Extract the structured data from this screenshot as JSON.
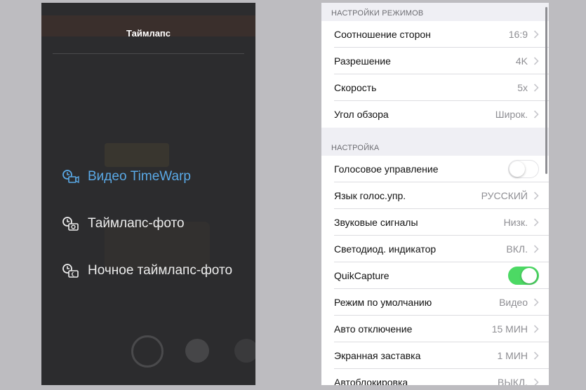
{
  "left": {
    "title": "Таймлапс",
    "modes": [
      {
        "label": "Видео TimeWarp",
        "icon": "timewarp-video-icon",
        "active": true
      },
      {
        "label": "Таймлапс-фото",
        "icon": "timelapse-photo-icon",
        "active": false
      },
      {
        "label": "Ночное таймлапс-фото",
        "icon": "night-timelapse-photo-icon",
        "active": false
      }
    ],
    "active_color": "#5aa9e6"
  },
  "right": {
    "sections": [
      {
        "header": "НАСТРОЙКИ РЕЖИМОВ",
        "rows": [
          {
            "label": "Соотношение сторон",
            "value": "16:9",
            "type": "chevron"
          },
          {
            "label": "Разрешение",
            "value": "4K",
            "type": "chevron"
          },
          {
            "label": "Скорость",
            "value": "5x",
            "type": "chevron"
          },
          {
            "label": "Угол обзора",
            "value": "Широк.",
            "type": "chevron"
          }
        ]
      },
      {
        "header": "НАСТРОЙКА",
        "rows": [
          {
            "label": "Голосовое управление",
            "type": "toggle",
            "on": false
          },
          {
            "label": "Язык голос.упр.",
            "value": "РУССКИЙ",
            "type": "chevron"
          },
          {
            "label": "Звуковые сигналы",
            "value": "Низк.",
            "type": "chevron"
          },
          {
            "label": "Светодиод. индикатор",
            "value": "ВКЛ.",
            "type": "chevron"
          },
          {
            "label": "QuikCapture",
            "type": "toggle",
            "on": true
          },
          {
            "label": "Режим по умолчанию",
            "value": "Видео",
            "type": "chevron"
          },
          {
            "label": "Авто отключение",
            "value": "15 МИН",
            "type": "chevron"
          },
          {
            "label": "Экранная заставка",
            "value": "1 МИН",
            "type": "chevron"
          },
          {
            "label": "Автоблокировка",
            "value": "ВЫКЛ.",
            "type": "chevron"
          }
        ]
      }
    ],
    "toggle_on_color": "#4cd964"
  }
}
